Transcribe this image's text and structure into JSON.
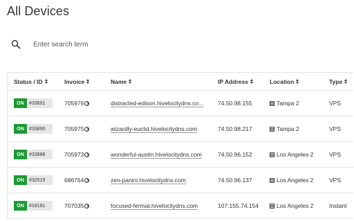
{
  "page": {
    "title": "All Devices"
  },
  "search": {
    "placeholder": "Enter search term"
  },
  "table": {
    "headers": {
      "status": "Status / ID",
      "invoice": "Invoice",
      "name": "Name",
      "ip": "IP Address",
      "location": "Location",
      "type": "Type"
    },
    "rows": [
      {
        "status": "ON",
        "id": "#33891",
        "invoice": "705976",
        "name": "distracted-edison.hivelocitydns.co...",
        "ip": "74.50.98.155",
        "location": "Tampa 2",
        "type": "VPS"
      },
      {
        "status": "ON",
        "id": "#33890",
        "invoice": "705975",
        "name": "wizardly-euclid.hivelocitydns.com",
        "ip": "74.50.98.217",
        "location": "Tampa 2",
        "type": "VPS"
      },
      {
        "status": "ON",
        "id": "#33888",
        "invoice": "705973",
        "name": "wonderful-austin.hivelocitydns.com",
        "ip": "74.50.96.152",
        "location": "Los Angeles 2",
        "type": "VPS"
      },
      {
        "status": "ON",
        "id": "#32519",
        "invoice": "686764",
        "name": "zen-panini.hivelocitydns.com",
        "ip": "74.50.96.137",
        "location": "Los Angeles 2",
        "type": "VPS"
      },
      {
        "status": "ON",
        "id": "#18181",
        "invoice": "707035",
        "name": "focused-fermat.hivelocitydns.com",
        "ip": "107.155.74.154",
        "location": "Los Angeles 2",
        "type": "Instant"
      }
    ]
  },
  "colors": {
    "status_on": "#1e9a35",
    "id_badge": "#e6e6e6",
    "border": "#e3e3e3"
  }
}
